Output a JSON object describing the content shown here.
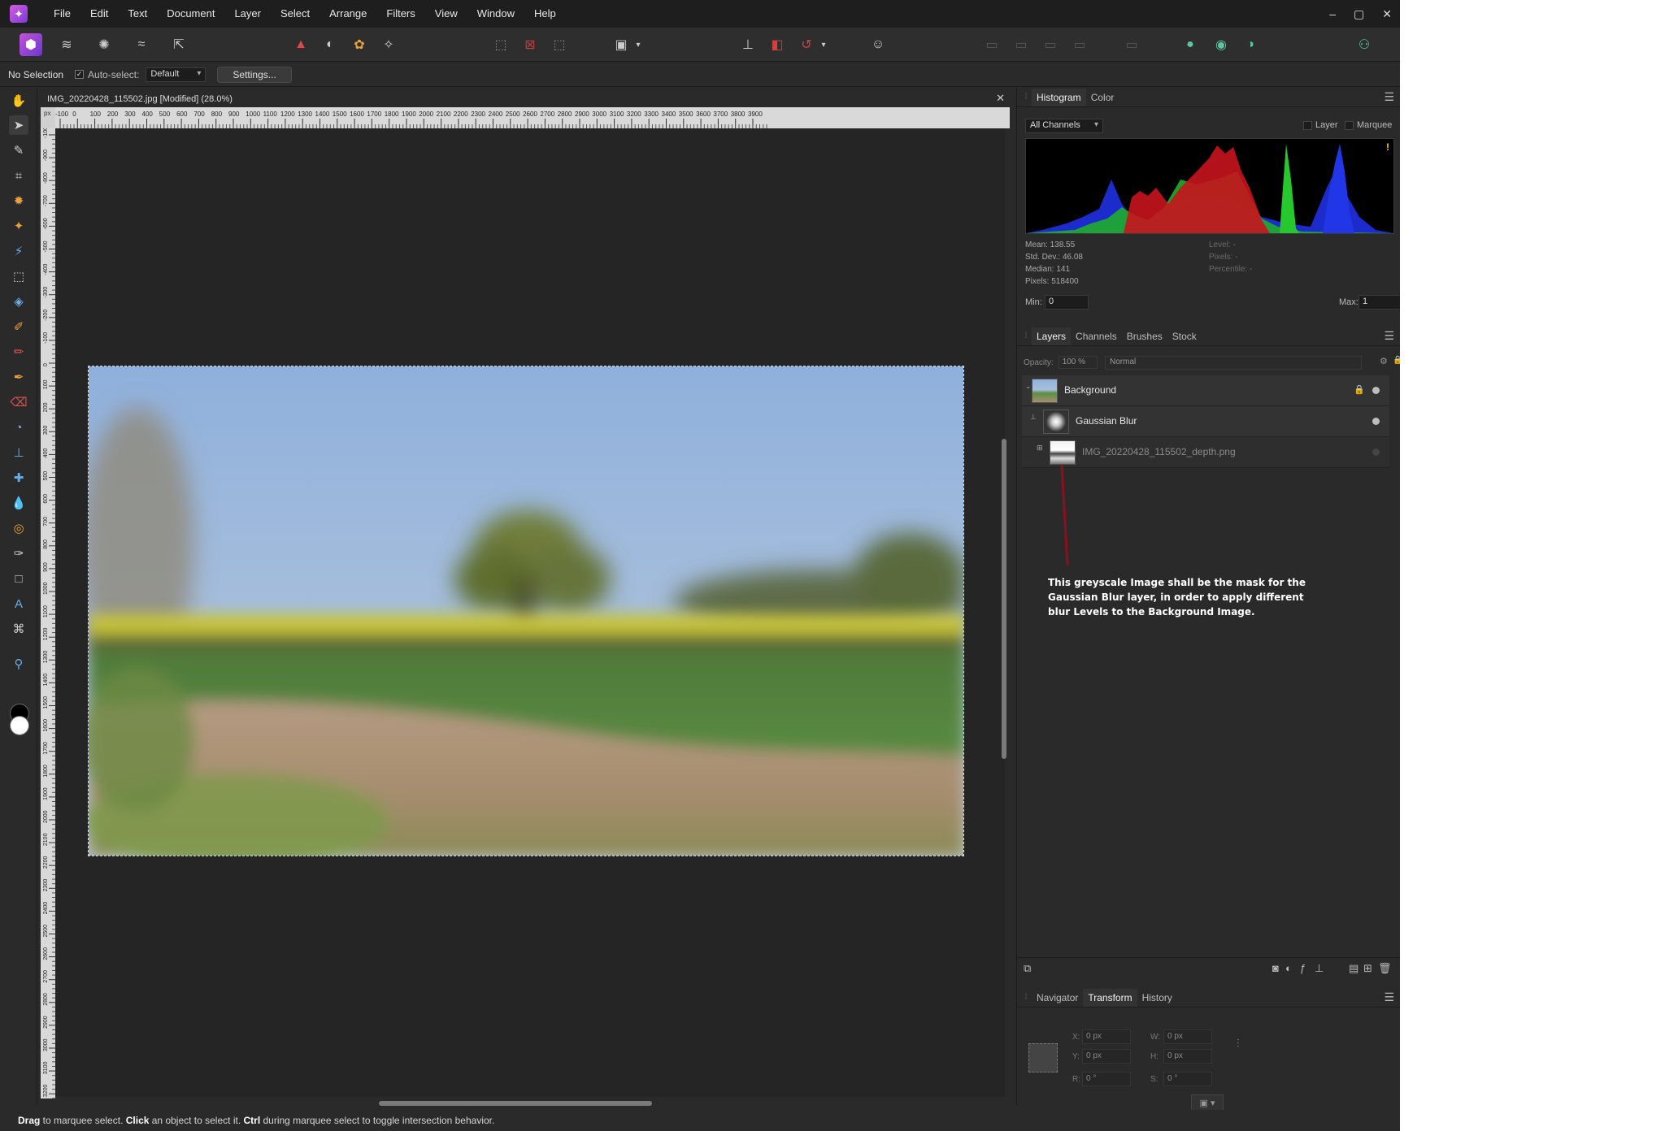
{
  "menu": [
    "File",
    "Edit",
    "Text",
    "Document",
    "Layer",
    "Select",
    "Arrange",
    "Filters",
    "View",
    "Window",
    "Help"
  ],
  "window_controls": [
    "–",
    "▢",
    "✕"
  ],
  "context": {
    "selection": "No Selection",
    "autoselect_label": "Auto-select:",
    "autoselect_value": "Default",
    "settings_label": "Settings..."
  },
  "document": {
    "tab_title": "IMG_20220428_115502.jpg [Modified] (28.0%)",
    "ruler_unit": "px",
    "ruler_h_ticks": [
      "-100",
      "0",
      "100",
      "200",
      "300",
      "400",
      "500",
      "600",
      "700",
      "800",
      "900",
      "1000",
      "1100",
      "1200",
      "1300",
      "1400",
      "1500",
      "1600",
      "1700",
      "1800",
      "1900",
      "2000",
      "2100",
      "2200",
      "2300",
      "2400",
      "2500",
      "2600",
      "2700",
      "2800",
      "2900",
      "3000",
      "3100",
      "3200",
      "3300",
      "3400",
      "3500",
      "3600",
      "3700",
      "3800",
      "3900"
    ],
    "ruler_v_ticks": [
      "-1000",
      "-900",
      "-800",
      "-700",
      "-600",
      "-500",
      "-400",
      "-300",
      "-200",
      "-100",
      "0",
      "100",
      "200",
      "300",
      "400",
      "500",
      "600",
      "700",
      "800",
      "900",
      "1000",
      "1100",
      "1200",
      "1300",
      "1400",
      "1500",
      "1600",
      "1700",
      "1800",
      "1900",
      "2000",
      "2100",
      "2200",
      "2300",
      "2400",
      "2500",
      "2600",
      "2700",
      "2800",
      "2900",
      "3000",
      "3100",
      "3200"
    ]
  },
  "histogram": {
    "tabs": [
      "Histogram",
      "Color"
    ],
    "channel": "All Channels",
    "opt_layer": "Layer",
    "opt_marquee": "Marquee",
    "stats": {
      "mean": "Mean: 138.55",
      "stddev": "Std. Dev.: 46.08",
      "median": "Median: 141",
      "pixels": "Pixels: 518400",
      "level": "Level: -",
      "pixels_sel": "Pixels: -",
      "percentile": "Percentile: -"
    },
    "min_label": "Min:",
    "min_value": "0",
    "max_label": "Max:",
    "max_value": "1",
    "warning": "!"
  },
  "layers": {
    "tabs": [
      "Layers",
      "Channels",
      "Brushes",
      "Stock"
    ],
    "opacity_label": "Opacity:",
    "opacity_value": "100 %",
    "blend_mode": "Normal",
    "items": [
      {
        "name": "Background"
      },
      {
        "name": "Gaussian Blur"
      },
      {
        "name": "IMG_20220428_115502_depth.png"
      }
    ]
  },
  "annotation": "This greyscale Image shall be the mask for the Gaussian Blur layer, in order to apply different blur Levels to the Background Image.",
  "annotation_color": "#8a1020",
  "nav": {
    "tabs": [
      "Navigator",
      "Transform",
      "History"
    ],
    "x_label": "X:",
    "x_value": "0 px",
    "y_label": "Y:",
    "y_value": "0 px",
    "w_label": "W:",
    "w_value": "0 px",
    "h_label": "H:",
    "h_value": "0 px",
    "r_label": "R:",
    "r_value": "0 °",
    "s_label": "S:",
    "s_value": "0 °"
  },
  "status": {
    "drag": "Drag",
    "t1": " to marquee select. ",
    "click": "Click",
    "t2": " an object to select it. ",
    "ctrl": "Ctrl",
    "t3": " during marquee select to toggle intersection behavior."
  },
  "colors": {
    "accent": "#b44fd8",
    "red_marker": "#e03040",
    "warning": "#f2c94c"
  }
}
